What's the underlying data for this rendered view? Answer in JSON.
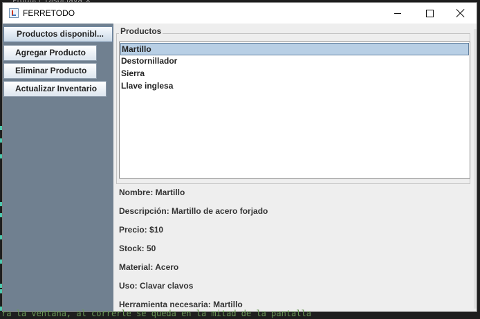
{
  "background": {
    "ide_tab_label": "Product_Displ.java  ×",
    "code_comment": "ra la ventana, al correrle se queda en la mitad de la pantalla"
  },
  "window": {
    "title": "FERRETODO",
    "controls": [
      "minimize-icon",
      "maximize-icon",
      "close-icon"
    ]
  },
  "sidebar": {
    "bg_color": "#708090",
    "buttons": [
      {
        "label": "Productos disponibl..."
      },
      {
        "label": "Agregar Producto"
      },
      {
        "label": "Eliminar Producto"
      },
      {
        "label": "Actualizar Inventario"
      }
    ]
  },
  "products_panel": {
    "legend": "Productos",
    "items": [
      {
        "label": "Martillo",
        "selected": true
      },
      {
        "label": "Destornillador"
      },
      {
        "label": "Sierra"
      },
      {
        "label": "Llave inglesa"
      }
    ]
  },
  "details": {
    "nombre": "Nombre: Martillo",
    "descripcion": "Descripción: Martillo de acero forjado",
    "precio": "Precio: $10",
    "stock": "Stock: 50",
    "material": "Material: Acero",
    "uso": "Uso: Clavar clavos",
    "herramienta": "Herramienta necesaria: Martillo"
  },
  "colors": {
    "selection": "#b8cfe5",
    "selection_border": "#6381a0"
  }
}
